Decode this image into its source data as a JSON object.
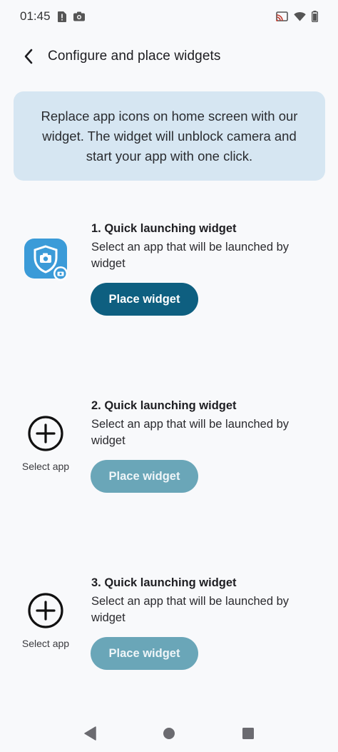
{
  "status_bar": {
    "time": "01:45",
    "icons": [
      "sim-alert-icon",
      "camera-icon",
      "cast-icon",
      "wifi-icon",
      "battery-icon"
    ]
  },
  "header": {
    "title": "Configure and place widgets",
    "back_icon": "chevron-left-icon"
  },
  "info_card": {
    "text": "Replace app icons on home screen with our widget. The widget will unblock camera and start your app with one click."
  },
  "widgets": [
    {
      "title": "1. Quick launching widget",
      "description": "Select an app that will be launched by widget",
      "button_label": "Place widget",
      "button_enabled": true,
      "icon": "camera-shield-app-icon"
    },
    {
      "title": "2. Quick launching widget",
      "description": "Select an app that will be launched by widget",
      "button_label": "Place widget",
      "button_enabled": false,
      "select_label": "Select app",
      "icon": "add-circle-icon"
    },
    {
      "title": "3. Quick launching widget",
      "description": "Select an app that will be launched by widget",
      "button_label": "Place widget",
      "button_enabled": false,
      "select_label": "Select app",
      "icon": "add-circle-icon"
    }
  ],
  "nav_bar": {
    "icons": [
      "back-triangle-icon",
      "home-circle-icon",
      "recents-square-icon"
    ]
  },
  "colors": {
    "primary_button": "#0e5f80",
    "disabled_button": "#6aa6b8",
    "info_card_bg": "#d6e6f2",
    "app_icon_blue": "#3b9bd8"
  }
}
